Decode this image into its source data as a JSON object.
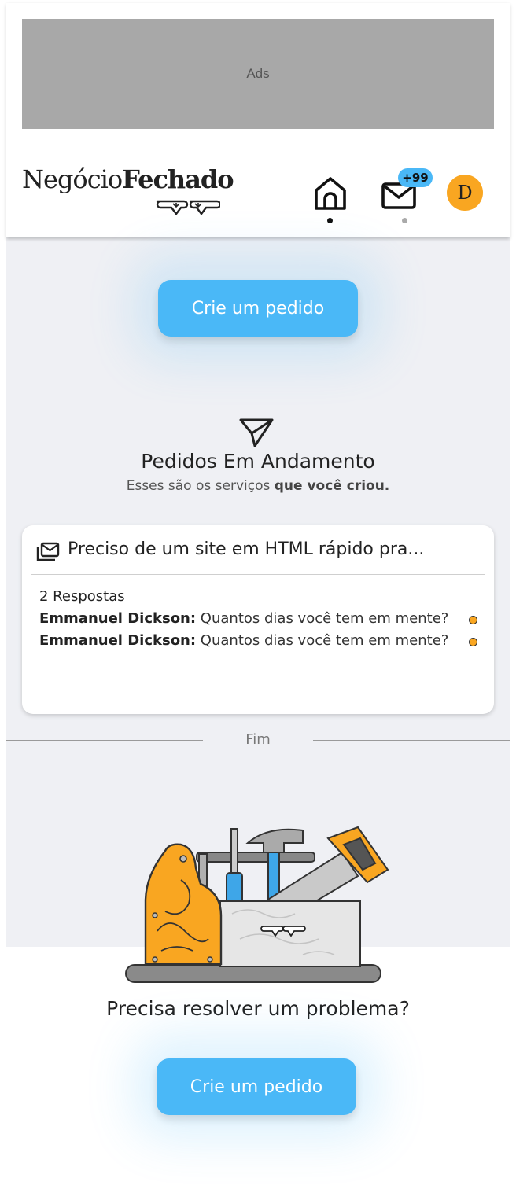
{
  "ads": {
    "label": "Ads"
  },
  "brand": {
    "name_part1": "Negócio",
    "name_part2": "Fechado"
  },
  "nav": {
    "home_icon": "home-icon",
    "mail_icon": "mail-icon",
    "mail_badge": "+99",
    "avatar_initial": "D"
  },
  "cta": {
    "label": "Crie um pedido"
  },
  "section": {
    "icon": "send-icon",
    "title": "Pedidos Em Andamento",
    "subtitle_prefix": "Esses são os serviços ",
    "subtitle_bold": "que você criou."
  },
  "request": {
    "icon": "mail-stack-icon",
    "title": "Preciso de um site em HTML rápido pra...",
    "responses": "2 Respostas",
    "messages": [
      {
        "author": "Emmanuel Dickson:",
        "text": " Quantos dias você tem em mente?"
      },
      {
        "author": "Emmanuel Dickson:",
        "text": " Quantos dias você tem em mente?"
      }
    ]
  },
  "end_label": "Fim",
  "footer": {
    "illustration": "toolbox-illustration",
    "question": "Precisa resolver um problema?",
    "cta_label": "Crie um pedido"
  },
  "colors": {
    "accent": "#4ab8f7",
    "avatar": "#f9a621",
    "background": "#eff0f4",
    "unread_dot": "#f9a621"
  }
}
